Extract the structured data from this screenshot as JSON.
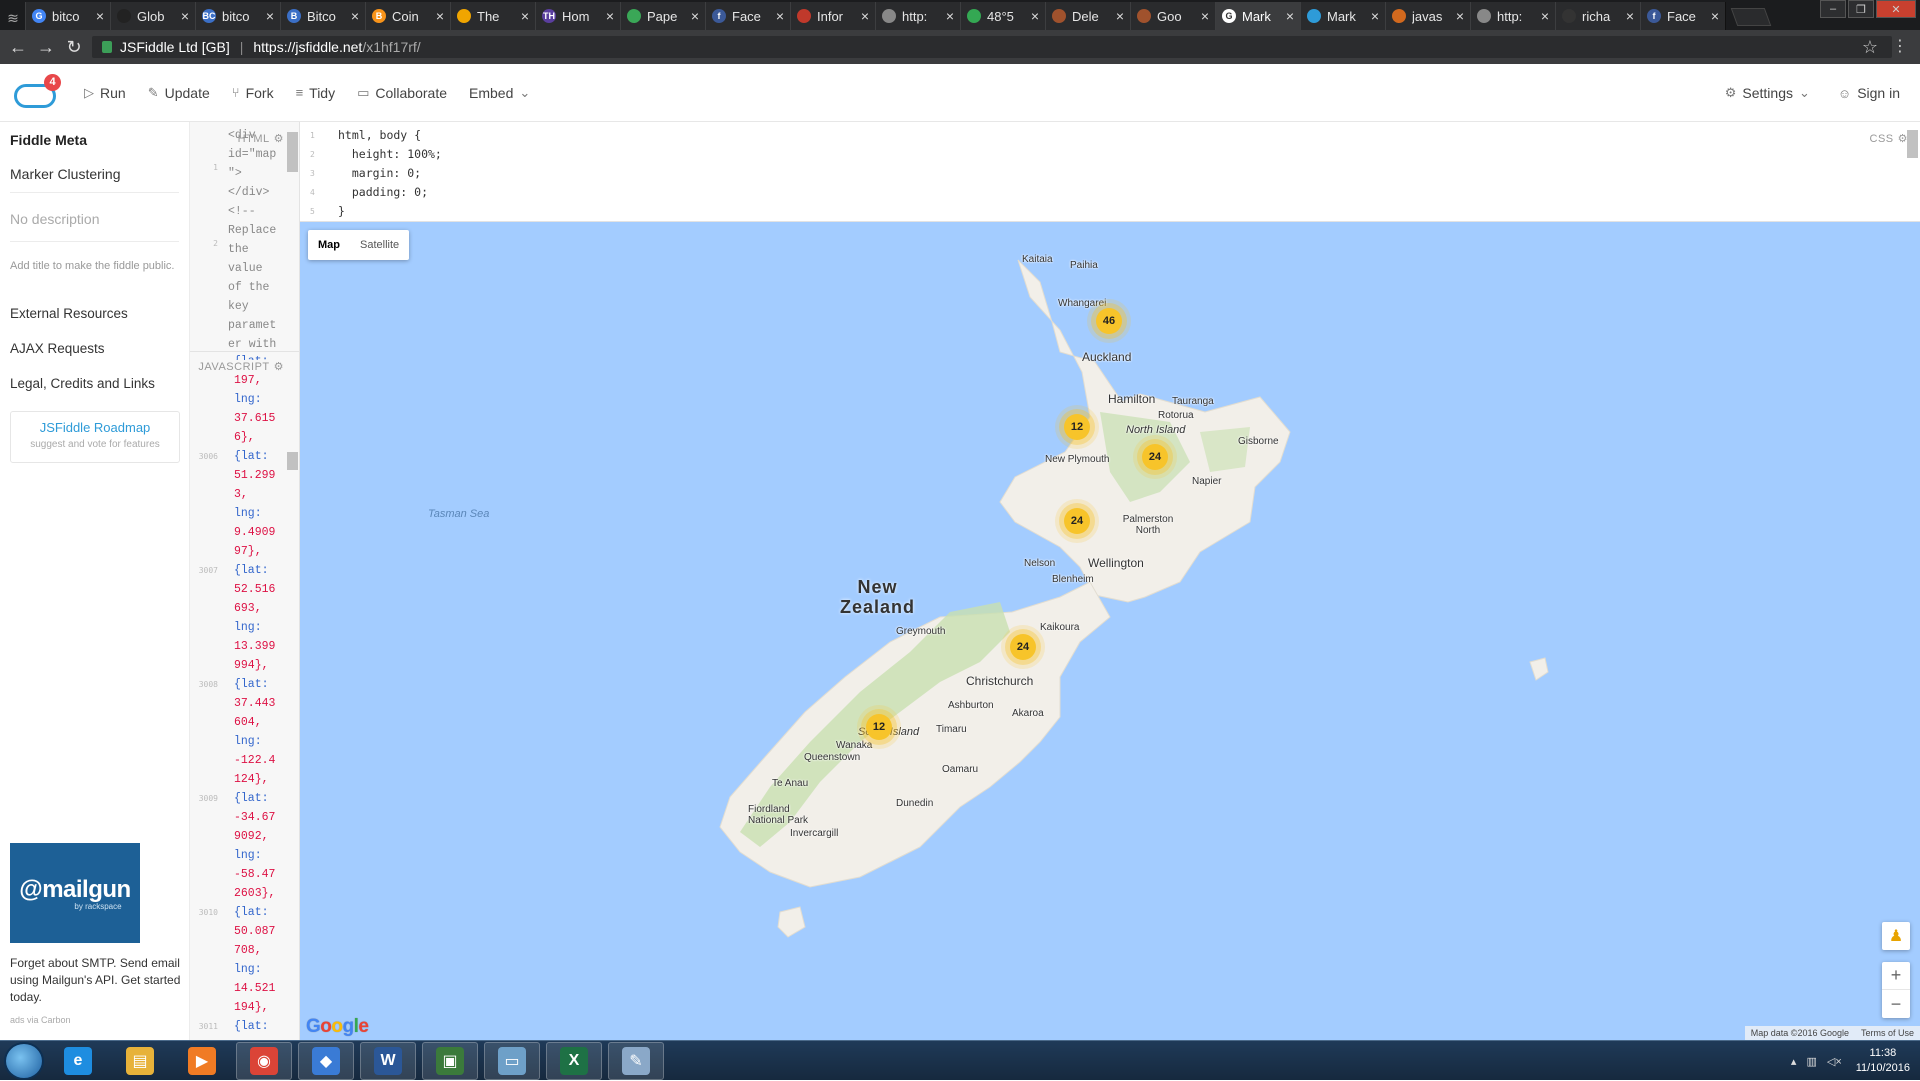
{
  "tabs": [
    {
      "label": "bitco",
      "color": "#4285f4",
      "glyph": "G"
    },
    {
      "label": "Glob",
      "color": "#222",
      "glyph": ""
    },
    {
      "label": "bitco",
      "color": "#3b6fc6",
      "glyph": "BC"
    },
    {
      "label": "Bitco",
      "color": "#3b6fc6",
      "glyph": "B"
    },
    {
      "label": "Coin",
      "color": "#f7931a",
      "glyph": "B"
    },
    {
      "label": "The",
      "color": "#f0a500",
      "glyph": ""
    },
    {
      "label": "Hom",
      "color": "#5a3e9e",
      "glyph": "TH"
    },
    {
      "label": "Pape",
      "color": "#3aa757",
      "glyph": ""
    },
    {
      "label": "Face",
      "color": "#3b5998",
      "glyph": "f"
    },
    {
      "label": "Infor",
      "color": "#c0392b",
      "glyph": ""
    },
    {
      "label": "http:",
      "color": "#888",
      "glyph": ""
    },
    {
      "label": "48°5",
      "color": "#34a853",
      "glyph": ""
    },
    {
      "label": "Dele",
      "color": "#a0522d",
      "glyph": ""
    },
    {
      "label": "Goo",
      "color": "#a0522d",
      "glyph": ""
    },
    {
      "label": "Mark",
      "color": "#fff",
      "glyph": "G"
    },
    {
      "label": "Mark",
      "color": "#2e9bd8",
      "glyph": ""
    },
    {
      "label": "javas",
      "color": "#d2691e",
      "glyph": ""
    },
    {
      "label": "http:",
      "color": "#888",
      "glyph": ""
    },
    {
      "label": "richa",
      "color": "#333",
      "glyph": ""
    },
    {
      "label": "Face",
      "color": "#3b5998",
      "glyph": "f"
    }
  ],
  "active_tab_index": 14,
  "window_controls": {
    "minimize": "–",
    "maximize": "❐",
    "close": "✕"
  },
  "address": {
    "org": "JSFiddle Ltd [GB]",
    "sep": "|",
    "host": "https://jsfiddle.net",
    "path": "/x1hf17rf/"
  },
  "toolbar": {
    "run": "Run",
    "update": "Update",
    "fork": "Fork",
    "tidy": "Tidy",
    "collaborate": "Collaborate",
    "embed": "Embed",
    "settings": "Settings",
    "signin": "Sign in",
    "badge_count": "4"
  },
  "sidebar": {
    "meta_title": "Fiddle Meta",
    "fiddle_title": "Marker Clustering",
    "description_placeholder": "No description",
    "hint": "Add title to make the fiddle public.",
    "links": [
      "External Resources",
      "AJAX Requests",
      "Legal, Credits and Links"
    ],
    "roadmap_title": "JSFiddle Roadmap",
    "roadmap_sub": "suggest and vote for features",
    "ad": {
      "brand": "@mailgun",
      "brand_sub": "by rackspace",
      "text": "Forget about SMTP. Send email using Mailgun's API. Get started today.",
      "footer": "ads via Carbon"
    }
  },
  "html_panel": {
    "label": "HTML",
    "gutter": [
      "1",
      "",
      "",
      "",
      "2"
    ],
    "code": "<div\nid=\"map\n\">\n</div>\n<!--\nReplace\nthe\nvalue\nof the\nkey\nparamet\ner with"
  },
  "js_panel": {
    "label": "JAVASCRIPT",
    "lines": [
      {
        "n": "",
        "t": "{lat:"
      },
      {
        "n": "",
        "t": "197,"
      },
      {
        "n": "",
        "t": "lng:"
      },
      {
        "n": "",
        "t": "37.615"
      },
      {
        "n": "",
        "t": "6},"
      },
      {
        "n": "3006",
        "t": "{lat:"
      },
      {
        "n": "",
        "t": "51.299"
      },
      {
        "n": "",
        "t": "3,"
      },
      {
        "n": "",
        "t": "lng:"
      },
      {
        "n": "",
        "t": "9.4909"
      },
      {
        "n": "",
        "t": "97},"
      },
      {
        "n": "3007",
        "t": "{lat:"
      },
      {
        "n": "",
        "t": "52.516"
      },
      {
        "n": "",
        "t": "693,"
      },
      {
        "n": "",
        "t": "lng:"
      },
      {
        "n": "",
        "t": "13.399"
      },
      {
        "n": "",
        "t": "994},"
      },
      {
        "n": "3008",
        "t": "{lat:"
      },
      {
        "n": "",
        "t": "37.443"
      },
      {
        "n": "",
        "t": "604,"
      },
      {
        "n": "",
        "t": "lng:"
      },
      {
        "n": "",
        "t": "-122.4"
      },
      {
        "n": "",
        "t": "124},"
      },
      {
        "n": "3009",
        "t": "{lat:"
      },
      {
        "n": "",
        "t": "-34.67"
      },
      {
        "n": "",
        "t": "9092,"
      },
      {
        "n": "",
        "t": "lng:"
      },
      {
        "n": "",
        "t": "-58.47"
      },
      {
        "n": "",
        "t": "2603},"
      },
      {
        "n": "3010",
        "t": "{lat:"
      },
      {
        "n": "",
        "t": "50.087"
      },
      {
        "n": "",
        "t": "708,"
      },
      {
        "n": "",
        "t": "lng:"
      },
      {
        "n": "",
        "t": "14.521"
      },
      {
        "n": "",
        "t": "194},"
      },
      {
        "n": "3011",
        "t": "{lat:"
      }
    ]
  },
  "css_panel": {
    "label": "CSS",
    "lines": [
      {
        "n": "1",
        "t": "html, body {"
      },
      {
        "n": "2",
        "t": "  height: 100%;"
      },
      {
        "n": "3",
        "t": "  margin: 0;"
      },
      {
        "n": "4",
        "t": "  padding: 0;"
      },
      {
        "n": "5",
        "t": "}"
      }
    ]
  },
  "map": {
    "type_buttons": [
      "Map",
      "Satellite"
    ],
    "country": "New\nZealand",
    "sea": "Tasman Sea",
    "islands": [
      "North Island",
      "South Island"
    ],
    "places": [
      "Kaitaia",
      "Paihia",
      "Whangarei",
      "Auckland",
      "Hamilton",
      "Tauranga",
      "Rotorua",
      "Gisborne",
      "New Plymouth",
      "Napier",
      "Palmerston North",
      "Nelson",
      "Wellington",
      "Blenheim",
      "Kaikoura",
      "Greymouth",
      "Christchurch",
      "Ashburton",
      "Akaroa",
      "Timaru",
      "Wanaka",
      "Queenstown",
      "Oamaru",
      "Te Anau",
      "Fiordland National Park",
      "Dunedin",
      "Invercargill"
    ],
    "clusters": [
      "46",
      "12",
      "24",
      "24",
      "24",
      "12"
    ],
    "attribution": [
      "Map data ©2016 Google",
      "Terms of Use"
    ],
    "google": [
      "G",
      "o",
      "o",
      "g",
      "l",
      "e"
    ],
    "zoom_in": "+",
    "zoom_out": "−",
    "land_color": "#f2efe9",
    "water_color": "#a3ccff",
    "park_color": "#c8e0b0"
  },
  "taskbar": {
    "apps": [
      {
        "name": "ie-icon",
        "glyph": "e",
        "color": "#1e8de0",
        "open": false
      },
      {
        "name": "explorer-icon",
        "glyph": "▤",
        "color": "#e7b23a",
        "open": false
      },
      {
        "name": "media-player-icon",
        "glyph": "▶",
        "color": "#f07b24",
        "open": false
      },
      {
        "name": "chrome-icon",
        "glyph": "◉",
        "color": "#db4437",
        "open": true
      },
      {
        "name": "app-icon",
        "glyph": "◆",
        "color": "#3a7bd5",
        "open": true
      },
      {
        "name": "word-icon",
        "glyph": "W",
        "color": "#2b5797",
        "open": true
      },
      {
        "name": "terminal-icon",
        "glyph": "▣",
        "color": "#3b7a3b",
        "open": true
      },
      {
        "name": "notepad-icon",
        "glyph": "▭",
        "color": "#6ea0c8",
        "open": true
      },
      {
        "name": "excel-icon",
        "glyph": "X",
        "color": "#1e7145",
        "open": true
      },
      {
        "name": "paint-icon",
        "glyph": "✎",
        "color": "#8aa8c8",
        "open": true
      }
    ],
    "time": "11:38",
    "date": "11/10/2016"
  }
}
